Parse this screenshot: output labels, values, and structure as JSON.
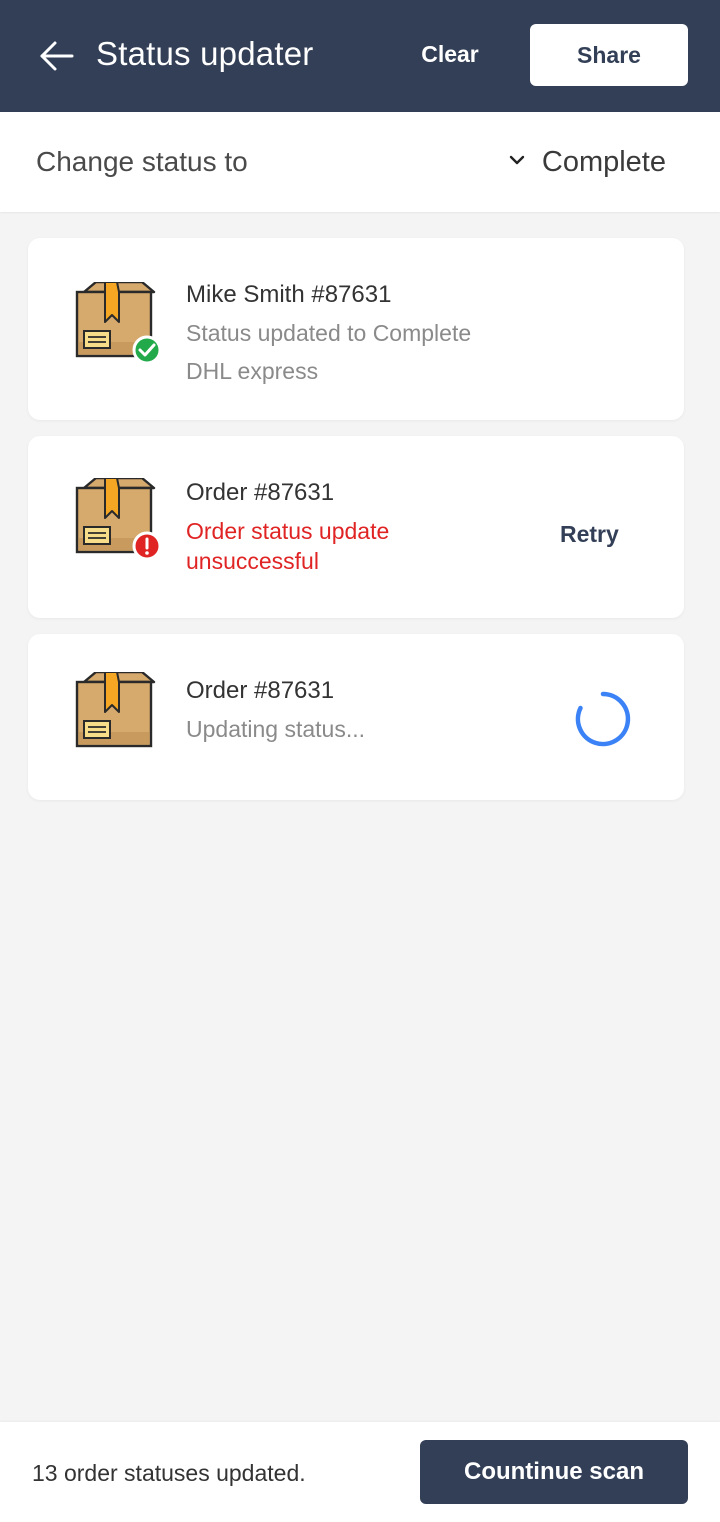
{
  "header": {
    "title": "Status updater",
    "clear_label": "Clear",
    "share_label": "Share",
    "background": "#323f57"
  },
  "status_bar": {
    "label": "Change status to",
    "selected": "Complete"
  },
  "cards": [
    {
      "title": "Mike Smith #87631",
      "subtitle": "Status updated to Complete",
      "carrier": "DHL express",
      "state": "success",
      "badge_icon": "check-circle-icon"
    },
    {
      "title": "Order #87631",
      "error": "Order status update unsuccessful",
      "action_label": "Retry",
      "state": "error",
      "badge_icon": "exclamation-circle-icon"
    },
    {
      "title": "Order #87631",
      "subtitle": "Updating status...",
      "state": "loading",
      "badge_icon": "spinner-icon"
    }
  ],
  "footer": {
    "summary": "13 order statuses updated.",
    "continue_label": "Countinue scan"
  },
  "colors": {
    "primary": "#323f57",
    "success": "#22a94a",
    "error": "#e02424",
    "spinner": "#3b82f6"
  }
}
